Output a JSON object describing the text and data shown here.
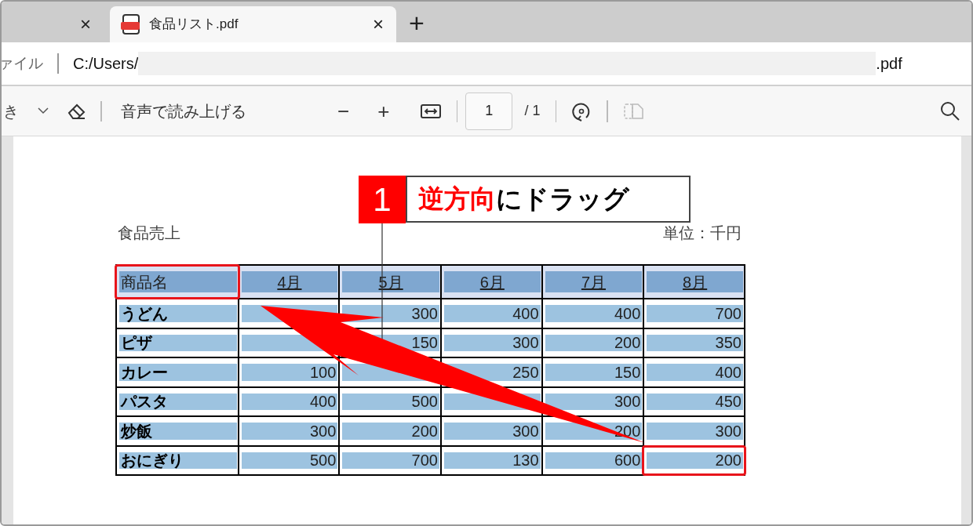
{
  "tabs": [
    {
      "selected": false,
      "close": "×"
    },
    {
      "label": "食品リスト.pdf",
      "selected": true,
      "close": "×"
    }
  ],
  "new_tab": "+",
  "address_bar": {
    "scheme_label": "ァイル",
    "path_start": "C:/Users/",
    "path_end": ".pdf"
  },
  "toolbar": {
    "cut_label": "き",
    "read_aloud": "音声で読み上げる",
    "zoom_out": "−",
    "zoom_in": "+",
    "page": "1",
    "page_total": "/ 1"
  },
  "document": {
    "title": "食品売上",
    "unit": "単位：千円",
    "table": {
      "selected": true,
      "columns": [
        {
          "label": "商品名",
          "marked": true
        },
        {
          "label": "4月",
          "marked": false
        },
        {
          "label": "5月",
          "marked": false
        },
        {
          "label": "6月",
          "marked": false
        },
        {
          "label": "7月",
          "marked": false
        },
        {
          "label": "8月",
          "marked": false
        }
      ],
      "rows": [
        {
          "cells": [
            {
              "text": "うどん",
              "marked": false
            },
            {
              "text": null,
              "marked": false
            },
            {
              "text": "300",
              "marked": false
            },
            {
              "text": "400",
              "marked": false
            },
            {
              "text": "400",
              "marked": false
            },
            {
              "text": "700",
              "marked": false
            }
          ]
        },
        {
          "cells": [
            {
              "text": "ピザ",
              "marked": false
            },
            {
              "text": null,
              "marked": false
            },
            {
              "text": "150",
              "marked": false
            },
            {
              "text": "300",
              "marked": false
            },
            {
              "text": "200",
              "marked": false
            },
            {
              "text": "350",
              "marked": false
            }
          ]
        },
        {
          "cells": [
            {
              "text": "カレー",
              "marked": false
            },
            {
              "text": "100",
              "marked": false
            },
            {
              "text": null,
              "marked": false
            },
            {
              "text": "250",
              "marked": false
            },
            {
              "text": "150",
              "marked": false
            },
            {
              "text": "400",
              "marked": false
            }
          ]
        },
        {
          "cells": [
            {
              "text": "パスタ",
              "marked": false
            },
            {
              "text": "400",
              "marked": false
            },
            {
              "text": "500",
              "marked": false
            },
            {
              "text": null,
              "marked": false
            },
            {
              "text": "300",
              "marked": false
            },
            {
              "text": "450",
              "marked": false
            }
          ]
        },
        {
          "cells": [
            {
              "text": "炒飯",
              "marked": false
            },
            {
              "text": "300",
              "marked": false
            },
            {
              "text": "200",
              "marked": false
            },
            {
              "text": "300",
              "marked": false
            },
            {
              "text": "200",
              "marked": false
            },
            {
              "text": "300",
              "marked": false
            }
          ]
        },
        {
          "cells": [
            {
              "text": "おにぎり",
              "marked": false
            },
            {
              "text": "500",
              "marked": false
            },
            {
              "text": "700",
              "marked": false
            },
            {
              "text": "130",
              "marked": false
            },
            {
              "text": "600",
              "marked": false
            },
            {
              "text": "200",
              "marked": true
            }
          ]
        }
      ]
    }
  },
  "callout": {
    "number": "1",
    "parts": [
      {
        "text": "逆方向",
        "emphasis": true
      },
      {
        "text": "にドラッグ",
        "emphasis": false
      }
    ]
  }
}
